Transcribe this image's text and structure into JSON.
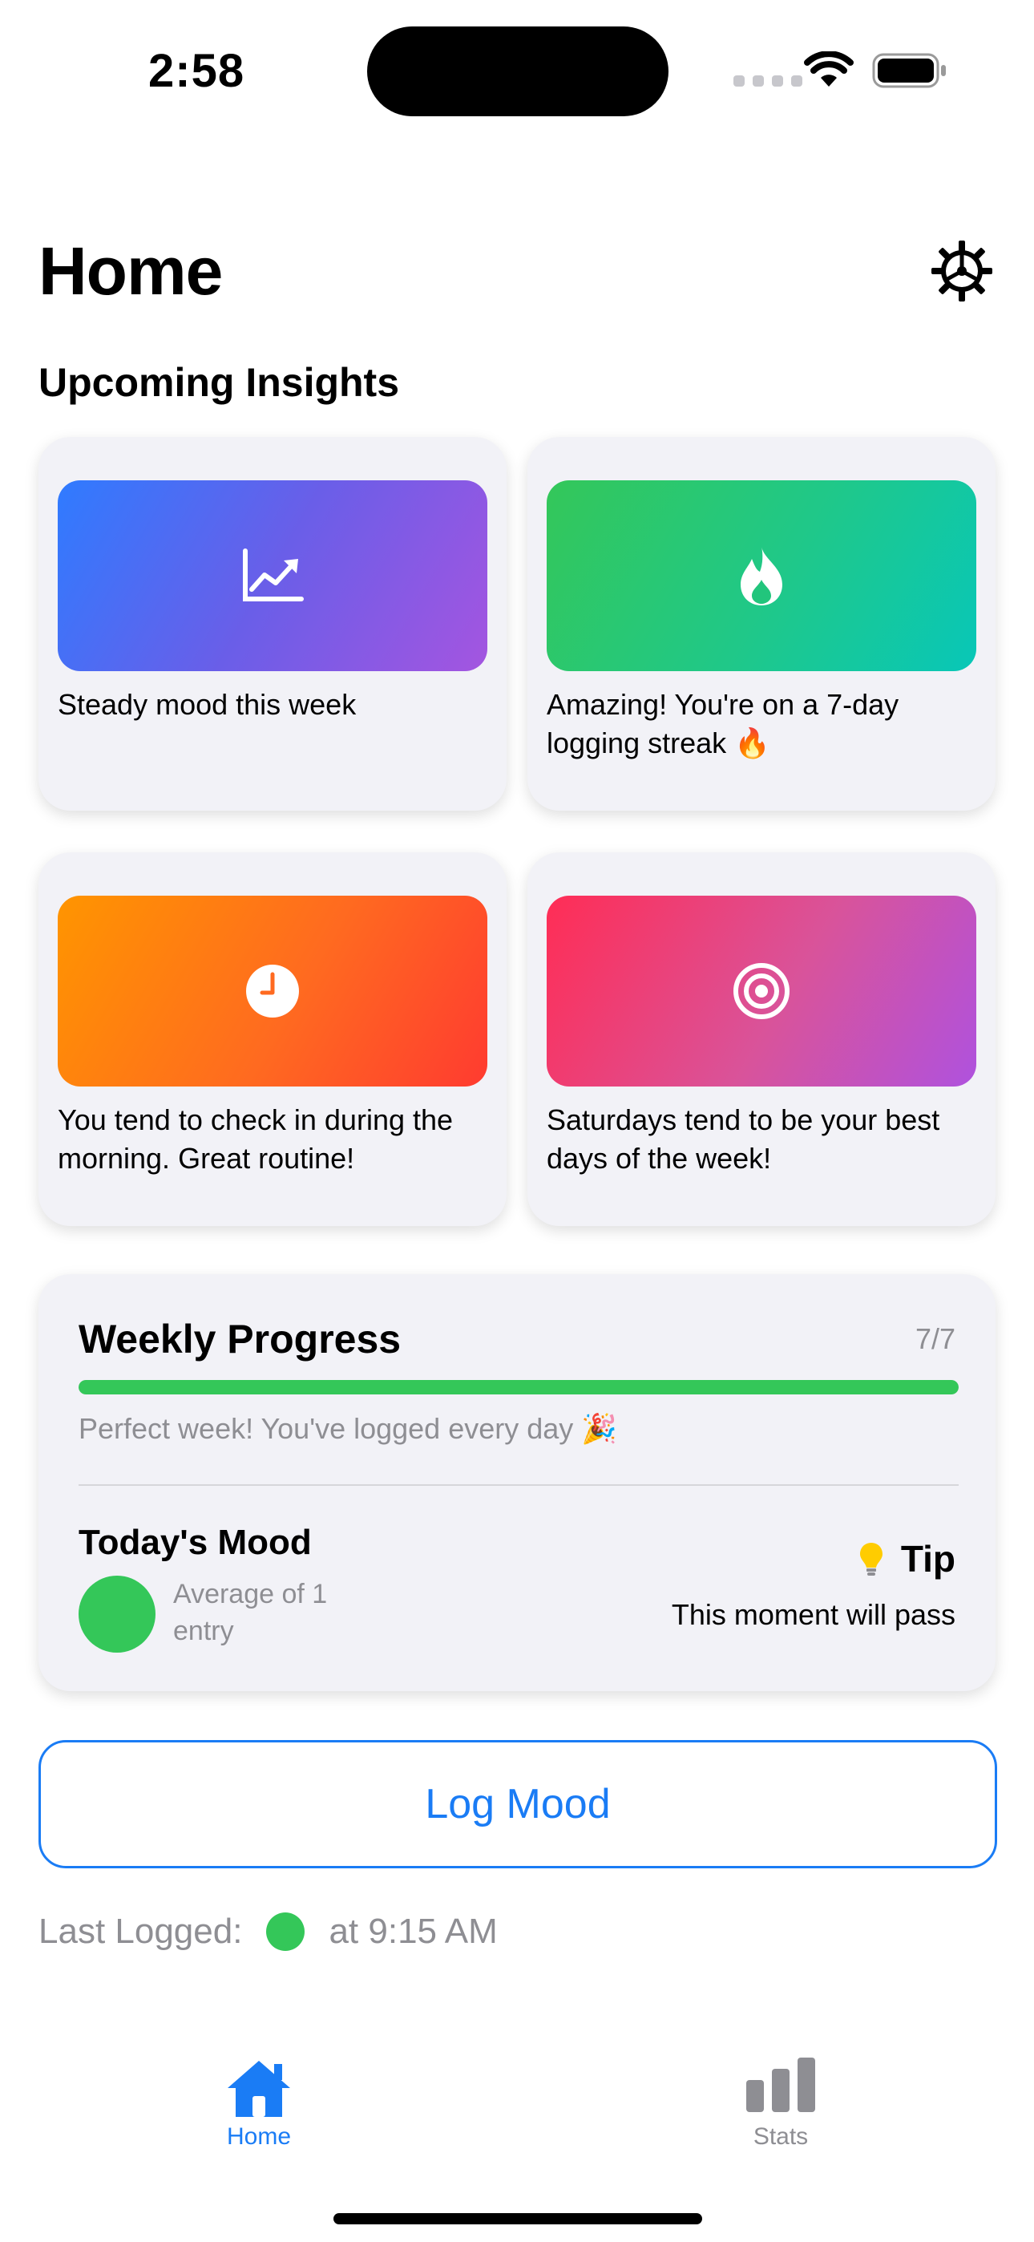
{
  "status_bar": {
    "time": "2:58"
  },
  "header": {
    "title": "Home"
  },
  "insights": {
    "title": "Upcoming Insights",
    "cards": [
      {
        "icon": "chart-line-up-icon",
        "text": "Steady mood this week"
      },
      {
        "icon": "flame-icon",
        "text": "Amazing! You're on a 7-day logging streak 🔥"
      },
      {
        "icon": "clock-icon",
        "text": "You tend to check in during the morning. Great routine!"
      },
      {
        "icon": "target-icon",
        "text": "Saturdays tend to be your best days of the week!"
      }
    ]
  },
  "weekly": {
    "title": "Weekly Progress",
    "count": "7/7",
    "progress": 1.0,
    "message": "Perfect week! You've logged every day 🎉"
  },
  "mood": {
    "title": "Today's Mood",
    "subtitle": "Average of 1 entry",
    "color": "#34c759",
    "tip_label": "Tip",
    "tip_text": "This moment will pass"
  },
  "actions": {
    "log_label": "Log Mood"
  },
  "last_logged": {
    "label": "Last Logged:",
    "time": "at 9:15 AM"
  },
  "tabs": [
    {
      "label": "Home",
      "icon": "house-icon",
      "active": true
    },
    {
      "label": "Stats",
      "icon": "bar-chart-icon",
      "active": false
    }
  ],
  "colors": {
    "accent": "#1a7cf5",
    "green": "#34c759",
    "inactive": "#8e8e93"
  }
}
